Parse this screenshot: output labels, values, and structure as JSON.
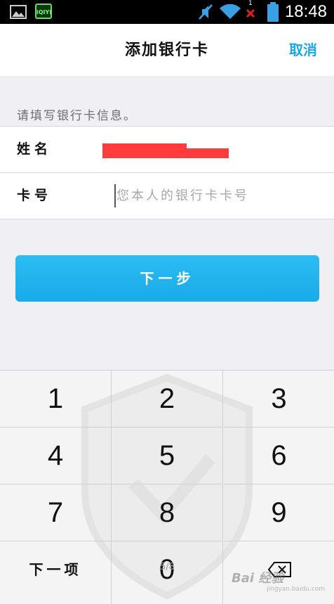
{
  "status_bar": {
    "time": "18:48",
    "sim_slot": "1",
    "icons": [
      "gallery-icon",
      "iqiyi-app-icon",
      "mute-icon",
      "wifi-icon",
      "no-signal-icon",
      "battery-icon"
    ],
    "app_icon_text": "iQIYI"
  },
  "nav": {
    "title": "添加银行卡",
    "cancel_label": "取消"
  },
  "form": {
    "hint": "请填写银行卡信息。",
    "name_label": "姓名",
    "card_label": "卡号",
    "card_placeholder": "您本人的银行卡卡号"
  },
  "next_button_label": "下一步",
  "keypad": {
    "keys": [
      "1",
      "2",
      "3",
      "4",
      "5",
      "6",
      "7",
      "8",
      "9"
    ],
    "next_item_label": "下一项",
    "zero": "0",
    "pager": "5/8"
  },
  "watermark": {
    "text": "Bai 经验",
    "sub": "jingyan.baidu.com"
  },
  "colors": {
    "accent": "#19a8e8",
    "redaction": "#ff3b3b",
    "status_bar": "#000000"
  }
}
